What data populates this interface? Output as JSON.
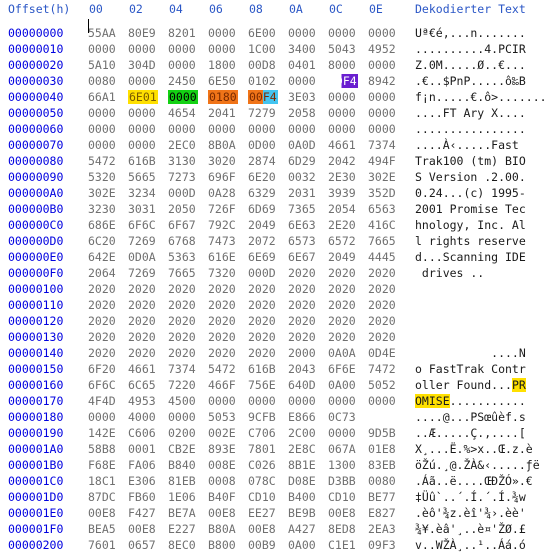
{
  "header": {
    "offset_label": "Offset(h)",
    "cols": [
      "00",
      "02",
      "04",
      "06",
      "08",
      "0A",
      "0C",
      "0E"
    ],
    "decoded_label": "Dekodierter Text"
  },
  "rows": [
    {
      "off": "00000000",
      "w": [
        "55AA",
        "80E9",
        "8201",
        "0000",
        "6E00",
        "0000",
        "0000",
        "0000"
      ],
      "t": "Uª€é,...n......."
    },
    {
      "off": "00000010",
      "w": [
        "0000",
        "0000",
        "0000",
        "0000",
        "1C00",
        "3400",
        "5043",
        "4952"
      ],
      "t": "..........4.PCIR"
    },
    {
      "off": "00000020",
      "w": [
        "5A10",
        "304D",
        "0000",
        "1800",
        "00D8",
        "0401",
        "8000",
        "0000"
      ],
      "t": "Z.0M.....Ø..€..."
    },
    {
      "off": "00000030",
      "w": [
        "0080",
        "0000",
        "2450",
        "6E50",
        "0102",
        "0000",
        "00F4",
        "8942"
      ],
      "t": ".€..$PnP.....ô‰B"
    },
    {
      "off": "00000040",
      "w": [
        "66A1",
        "6E01",
        "0000",
        "0180",
        "00F4",
        "3E03",
        "0000",
        "0000"
      ],
      "t": "f¡n.....€.ô>......."
    },
    {
      "off": "00000050",
      "w": [
        "0000",
        "0000",
        "4654",
        "2041",
        "7279",
        "2058",
        "0000",
        "0000"
      ],
      "t": "....FT Ary X...."
    },
    {
      "off": "00000060",
      "w": [
        "0000",
        "0000",
        "0000",
        "0000",
        "0000",
        "0000",
        "0000",
        "0000"
      ],
      "t": "................"
    },
    {
      "off": "00000070",
      "w": [
        "0000",
        "0000",
        "2EC0",
        "8B0A",
        "0D00",
        "0A0D",
        "4661",
        "7374"
      ],
      "t": "....À‹.....Fast"
    },
    {
      "off": "00000080",
      "w": [
        "5472",
        "616B",
        "3130",
        "3020",
        "2874",
        "6D29",
        "2042",
        "494F"
      ],
      "t": "Trak100 (tm) BIO"
    },
    {
      "off": "00000090",
      "w": [
        "5320",
        "5665",
        "7273",
        "696F",
        "6E20",
        "0032",
        "2E30",
        "302E"
      ],
      "t": "S Version .2.00."
    },
    {
      "off": "000000A0",
      "w": [
        "302E",
        "3234",
        "000D",
        "0A28",
        "6329",
        "2031",
        "3939",
        "352D"
      ],
      "t": "0.24...(c) 1995-"
    },
    {
      "off": "000000B0",
      "w": [
        "3230",
        "3031",
        "2050",
        "726F",
        "6D69",
        "7365",
        "2054",
        "6563"
      ],
      "t": "2001 Promise Tec"
    },
    {
      "off": "000000C0",
      "w": [
        "686E",
        "6F6C",
        "6F67",
        "792C",
        "2049",
        "6E63",
        "2E20",
        "416C"
      ],
      "t": "hnology, Inc. Al"
    },
    {
      "off": "000000D0",
      "w": [
        "6C20",
        "7269",
        "6768",
        "7473",
        "2072",
        "6573",
        "6572",
        "7665"
      ],
      "t": "l rights reserve"
    },
    {
      "off": "000000E0",
      "w": [
        "642E",
        "0D0A",
        "5363",
        "616E",
        "6E69",
        "6E67",
        "2049",
        "4445"
      ],
      "t": "d...Scanning IDE"
    },
    {
      "off": "000000F0",
      "w": [
        "2064",
        "7269",
        "7665",
        "7320",
        "000D",
        "2020",
        "2020",
        "2020"
      ],
      "t": " drives ..      "
    },
    {
      "off": "00000100",
      "w": [
        "2020",
        "2020",
        "2020",
        "2020",
        "2020",
        "2020",
        "2020",
        "2020"
      ],
      "t": ""
    },
    {
      "off": "00000110",
      "w": [
        "2020",
        "2020",
        "2020",
        "2020",
        "2020",
        "2020",
        "2020",
        "2020"
      ],
      "t": ""
    },
    {
      "off": "00000120",
      "w": [
        "2020",
        "2020",
        "2020",
        "2020",
        "2020",
        "2020",
        "2020",
        "2020"
      ],
      "t": ""
    },
    {
      "off": "00000130",
      "w": [
        "2020",
        "2020",
        "2020",
        "2020",
        "2020",
        "2020",
        "2020",
        "2020"
      ],
      "t": ""
    },
    {
      "off": "00000140",
      "w": [
        "2020",
        "2020",
        "2020",
        "2020",
        "2020",
        "2000",
        "0A0A",
        "0D4E"
      ],
      "t": "           ....N"
    },
    {
      "off": "00000150",
      "w": [
        "6F20",
        "4661",
        "7374",
        "5472",
        "616B",
        "2043",
        "6F6E",
        "7472"
      ],
      "t": "o FastTrak Contr"
    },
    {
      "off": "00000160",
      "w": [
        "6F6C",
        "6C65",
        "7220",
        "466F",
        "756E",
        "640D",
        "0A00",
        "5052"
      ],
      "t": "oller Found...PR"
    },
    {
      "off": "00000170",
      "w": [
        "4F4D",
        "4953",
        "4500",
        "0000",
        "0000",
        "0000",
        "0000",
        "0000"
      ],
      "t": "OMISE..........."
    },
    {
      "off": "00000180",
      "w": [
        "0000",
        "4000",
        "0000",
        "5053",
        "9CFB",
        "E866",
        "0C73"
      ],
      "t": "....@...PSœûèf.s"
    },
    {
      "off": "00000190",
      "w": [
        "142E",
        "C606",
        "0200",
        "002E",
        "C706",
        "2C00",
        "0000",
        "9D5B"
      ],
      "t": "..Æ.....Ç.,....["
    },
    {
      "off": "000001A0",
      "w": [
        "58B8",
        "0001",
        "CB2E",
        "893E",
        "7801",
        "2E8C",
        "067A",
        "01E8"
      ],
      "t": "X¸...Ë.%>x..Œ.z.è"
    },
    {
      "off": "000001B0",
      "w": [
        "F68E",
        "FA06",
        "B840",
        "008E",
        "C026",
        "8B1E",
        "1300",
        "83EB"
      ],
      "t": "öŽú.¸@.ŽÀ&‹.....ƒë"
    },
    {
      "off": "000001C0",
      "w": [
        "18C1",
        "E306",
        "81EB",
        "0008",
        "078C",
        "D08E",
        "D3BB",
        "0080"
      ],
      "t": ".Áã..ë....ŒÐŽÓ».€"
    },
    {
      "off": "000001D0",
      "w": [
        "87DC",
        "FB60",
        "1E06",
        "B40F",
        "CD10",
        "B400",
        "CD10",
        "BE77"
      ],
      "t": "‡Üû`..´.Í.´.Í.¾w"
    },
    {
      "off": "000001E0",
      "w": [
        "00E8",
        "F427",
        "BE7A",
        "00E8",
        "EE27",
        "BE9B",
        "00E8",
        "E827"
      ],
      "t": ".èô'¾z.èî'¾›.èè'"
    },
    {
      "off": "000001F0",
      "w": [
        "BEA5",
        "00E8",
        "E227",
        "B80A",
        "00E8",
        "A427",
        "8ED8",
        "2EA3"
      ],
      "t": "¾¥.èâ'¸..è¤'ŽØ.£"
    },
    {
      "off": "00000200",
      "w": [
        "7601",
        "0657",
        "8EC0",
        "B800",
        "00B9",
        "0A00",
        "C1E1",
        "09F3"
      ],
      "t": "v..WŽÀ¸..¹..Áá.ó"
    }
  ],
  "highlights": {
    "yellow": "#ffe000",
    "green": "#13d113",
    "orange": "#f07418",
    "cyan": "#44c4f0",
    "purple": "#6a1fd0"
  }
}
